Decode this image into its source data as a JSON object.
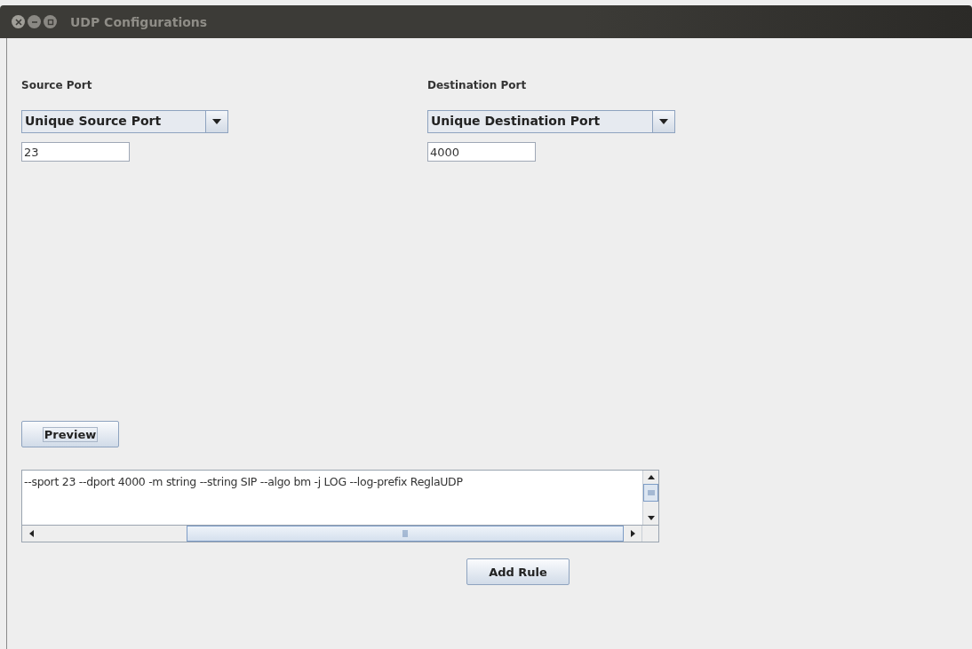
{
  "window": {
    "title": "UDP Configurations"
  },
  "source": {
    "label": "Source Port",
    "combo": "Unique Source Port",
    "value": "23"
  },
  "destination": {
    "label": "Destination Port",
    "combo": "Unique Destination Port",
    "value": "4000"
  },
  "preview_button": "Preview",
  "output": {
    "text": "--sport 23 --dport 4000 -m string --string SIP --algo bm -j LOG --log-prefix ReglaUDP"
  },
  "add_button": "Add Rule"
}
